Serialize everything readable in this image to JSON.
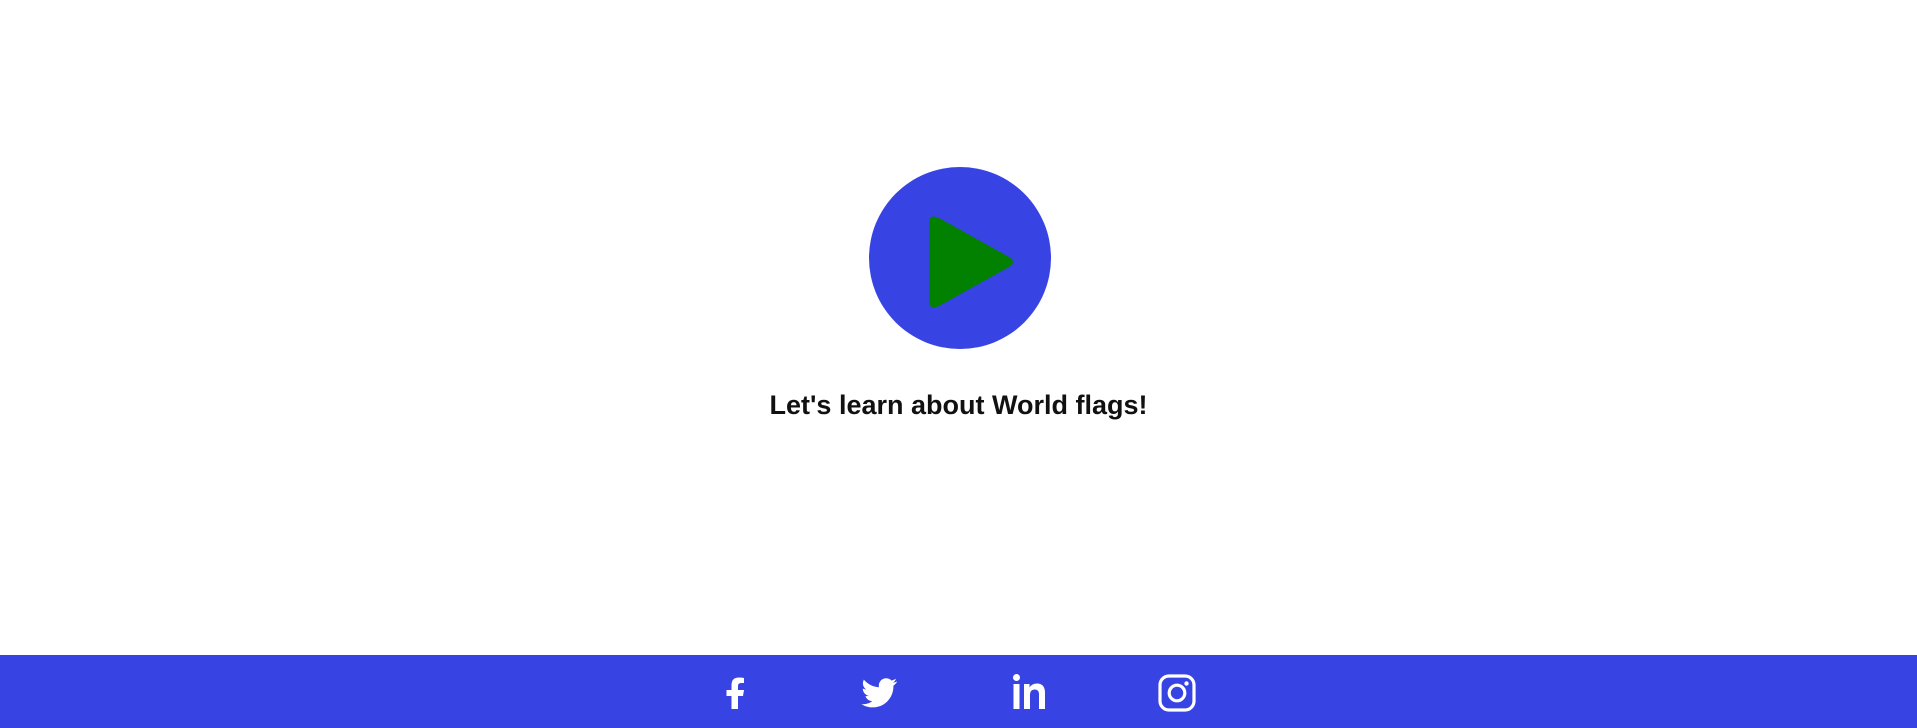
{
  "hero": {
    "tagline": "Let's learn about World flags!",
    "play_button": {
      "icon": "play-icon"
    }
  },
  "footer": {
    "social_links": [
      {
        "name": "facebook",
        "icon": "facebook-icon"
      },
      {
        "name": "twitter",
        "icon": "twitter-icon"
      },
      {
        "name": "linkedin",
        "icon": "linkedin-icon"
      },
      {
        "name": "instagram",
        "icon": "instagram-icon"
      }
    ]
  },
  "colors": {
    "brand_blue": "#3843e3",
    "play_green": "#028000",
    "text": "#111111",
    "background": "#ffffff",
    "icon_white": "#ffffff"
  }
}
